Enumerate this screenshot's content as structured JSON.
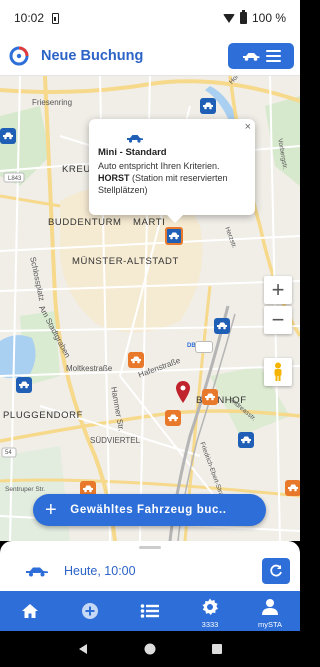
{
  "status_bar": {
    "time": "10:02",
    "battery": "100 %"
  },
  "header": {
    "title": "Neue Buchung",
    "logo_icon": "logo-circle-icon",
    "car_menu_icon": "car-menu-icon"
  },
  "map": {
    "labels": {
      "kreuz": "KREU",
      "buddenturm": "BUDDENTURM",
      "marti": "MARTI",
      "altstadt": "MÜNSTER-ALTSTADT",
      "moltke": "Moltkestraße",
      "hammer": "Hammer Str.",
      "pluggendorf": "PLUGGENDORF",
      "suedviertel": "SÜDVIERTEL",
      "bahnhof": "BAHNHOF",
      "friesenring": "Friesenring",
      "schlossplatz": "Schlossplatz",
      "am_stadtgraben": "Am Stadtgraben",
      "hoher_heckenweg": "Hoher Heckenweg",
      "vorbergstr": "Vorbergstr.",
      "herzstr": "Herzstr.",
      "andreasstr": "Andreasstr.",
      "friedrich_ebert": "Friedrich-Ebert-Straße",
      "hafenstr": "Hafenstraße",
      "l843": "L843",
      "b54": "54",
      "sentruper": "Sentruper Str.",
      "db": "DB"
    },
    "zoom_in": "+",
    "zoom_out": "−",
    "colors": {
      "station_blue": "#1f5fb5",
      "station_orange": "#e8782a",
      "marker_red": "#c0232c"
    }
  },
  "popup": {
    "close": "×",
    "vehicle_class": "Mini - Standard",
    "criteria_text": "Auto entspricht Ihren Kriterien.",
    "station_name": "HORST",
    "station_desc": " (Station mit reservierten Stellplätzen)"
  },
  "book_button": {
    "plus": "+",
    "label": "Gewähltes Fahrzeug buc.."
  },
  "bottom_sheet": {
    "time_label": "Heute, 10:00"
  },
  "bottom_nav": {
    "items": [
      {
        "icon": "home-icon",
        "label": ""
      },
      {
        "icon": "add-circle-icon",
        "label": ""
      },
      {
        "icon": "list-icon",
        "label": ""
      },
      {
        "icon": "gear-icon",
        "label": "3333"
      },
      {
        "icon": "user-icon",
        "label": "mySTA"
      }
    ]
  },
  "accent_color": "#2e6ed8"
}
